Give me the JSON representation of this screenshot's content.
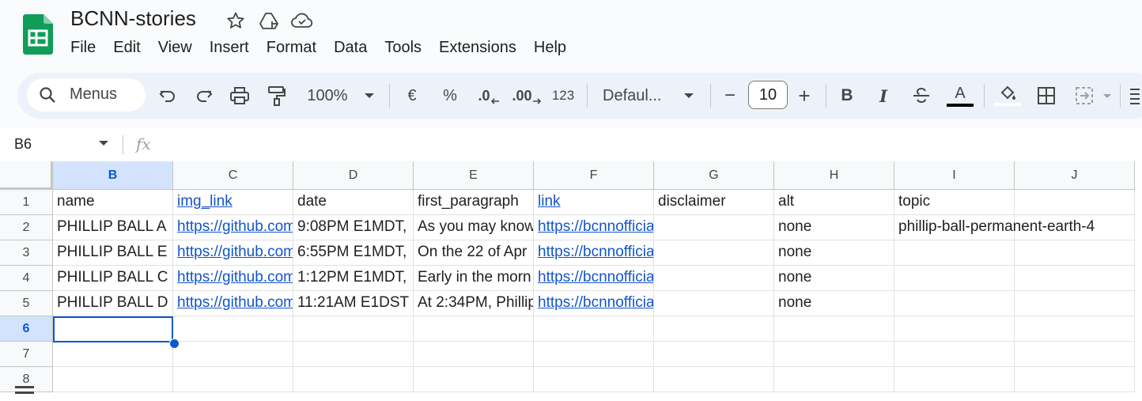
{
  "document": {
    "title": "BCNN-stories"
  },
  "menu": [
    "File",
    "Edit",
    "View",
    "Insert",
    "Format",
    "Data",
    "Tools",
    "Extensions",
    "Help"
  ],
  "toolbar": {
    "search_label": "Menus",
    "zoom": "100%",
    "currency": "€",
    "percent": "%",
    "decrease_decimal": ".0",
    "increase_decimal": ".00",
    "number_format": "123",
    "font": "Defaul...",
    "font_size": "10",
    "minus": "−",
    "plus": "+",
    "bold": "B",
    "italic": "I",
    "text_color": "A"
  },
  "formula_bar": {
    "name_box": "B6",
    "fx": "fx",
    "value": ""
  },
  "grid": {
    "columns": [
      "B",
      "C",
      "D",
      "E",
      "F",
      "G",
      "H",
      "I",
      "J"
    ],
    "selected_column": "B",
    "rows": [
      "1",
      "2",
      "3",
      "4",
      "5",
      "6",
      "7",
      "8"
    ],
    "selected_row": "6",
    "cells": [
      [
        "name",
        "img_link",
        "date",
        "first_paragraph",
        "link",
        "disclaimer",
        "alt",
        "topic",
        ""
      ],
      [
        "PHILLIP BALL A",
        "https://github.com",
        "9:08PM E1MDT,",
        "As you may know",
        "https://bcnnofficial",
        "",
        "none",
        "phillip-ball-permanent-earth-4",
        ""
      ],
      [
        "PHILLIP BALL E",
        "https://github.com",
        "6:55PM E1MDT,",
        "On the 22 of Apr",
        "https://bcnnofficial",
        "",
        "none",
        "",
        ""
      ],
      [
        "PHILLIP BALL C",
        "https://github.com",
        "1:12PM E1MDT,",
        "Early in the morn",
        "https://bcnnofficial",
        "",
        "none",
        "",
        ""
      ],
      [
        "PHILLIP BALL D",
        "https://github.com",
        "11:21AM E1DST",
        "At 2:34PM, Phillip",
        "https://bcnnofficial",
        "",
        "none",
        "",
        ""
      ],
      [
        "",
        "",
        "",
        "",
        "",
        "",
        "",
        "",
        ""
      ],
      [
        "",
        "",
        "",
        "",
        "",
        "",
        "",
        "",
        ""
      ],
      [
        "",
        "",
        "",
        "",
        "",
        "",
        "",
        "",
        ""
      ]
    ],
    "link_columns": [
      "C",
      "F"
    ]
  },
  "colors": {
    "accent": "#0b57d0",
    "link": "#1155cc",
    "sheets_green": "#0f9d58"
  }
}
